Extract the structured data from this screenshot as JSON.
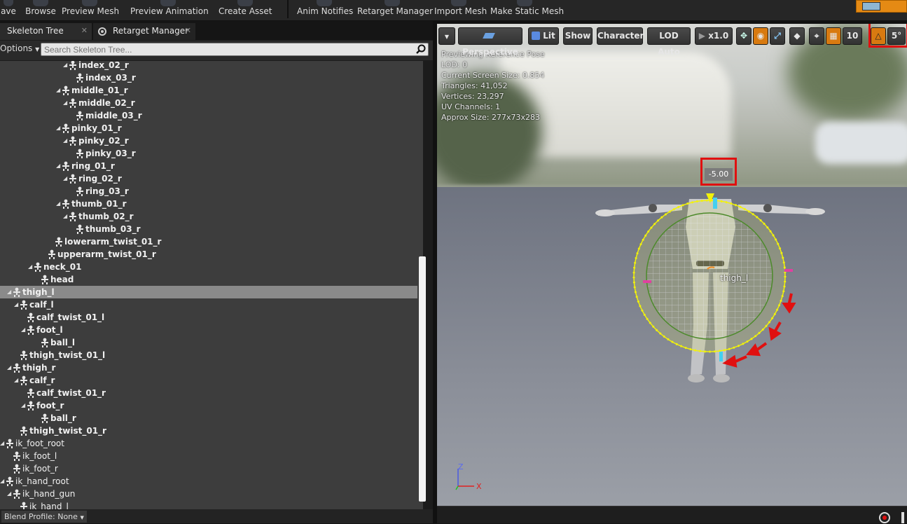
{
  "toolbar": {
    "items": [
      "ave",
      "Browse",
      "Preview Mesh",
      "Preview Animation",
      "Create Asset",
      "Anim Notifies",
      "Retarget Manager",
      "Import Mesh",
      "Make Static Mesh"
    ]
  },
  "tabs": {
    "skeleton_tree": "Skeleton Tree",
    "retarget_manager": "Retarget Manager",
    "close": "✕"
  },
  "options_label": "Options",
  "search": {
    "placeholder": "Search Skeleton Tree..."
  },
  "tree": [
    {
      "label": "index_02_r",
      "depth": 9,
      "expanded": true,
      "bold": true
    },
    {
      "label": "index_03_r",
      "depth": 10,
      "expanded": false,
      "bold": true
    },
    {
      "label": "middle_01_r",
      "depth": 8,
      "expanded": true,
      "bold": true
    },
    {
      "label": "middle_02_r",
      "depth": 9,
      "expanded": true,
      "bold": true
    },
    {
      "label": "middle_03_r",
      "depth": 10,
      "expanded": false,
      "bold": true
    },
    {
      "label": "pinky_01_r",
      "depth": 8,
      "expanded": true,
      "bold": true
    },
    {
      "label": "pinky_02_r",
      "depth": 9,
      "expanded": true,
      "bold": true
    },
    {
      "label": "pinky_03_r",
      "depth": 10,
      "expanded": false,
      "bold": true
    },
    {
      "label": "ring_01_r",
      "depth": 8,
      "expanded": true,
      "bold": true
    },
    {
      "label": "ring_02_r",
      "depth": 9,
      "expanded": true,
      "bold": true
    },
    {
      "label": "ring_03_r",
      "depth": 10,
      "expanded": false,
      "bold": true
    },
    {
      "label": "thumb_01_r",
      "depth": 8,
      "expanded": true,
      "bold": true
    },
    {
      "label": "thumb_02_r",
      "depth": 9,
      "expanded": true,
      "bold": true
    },
    {
      "label": "thumb_03_r",
      "depth": 10,
      "expanded": false,
      "bold": true
    },
    {
      "label": "lowerarm_twist_01_r",
      "depth": 7,
      "expanded": false,
      "bold": true
    },
    {
      "label": "upperarm_twist_01_r",
      "depth": 6,
      "expanded": false,
      "bold": true
    },
    {
      "label": "neck_01",
      "depth": 4,
      "expanded": true,
      "bold": true
    },
    {
      "label": "head",
      "depth": 5,
      "expanded": false,
      "bold": true
    },
    {
      "label": "thigh_l",
      "depth": 1,
      "expanded": true,
      "bold": true,
      "selected": true
    },
    {
      "label": "calf_l",
      "depth": 2,
      "expanded": true,
      "bold": true
    },
    {
      "label": "calf_twist_01_l",
      "depth": 3,
      "expanded": false,
      "bold": true
    },
    {
      "label": "foot_l",
      "depth": 3,
      "expanded": true,
      "bold": true
    },
    {
      "label": "ball_l",
      "depth": 5,
      "expanded": false,
      "bold": true
    },
    {
      "label": "thigh_twist_01_l",
      "depth": 2,
      "expanded": false,
      "bold": true
    },
    {
      "label": "thigh_r",
      "depth": 1,
      "expanded": true,
      "bold": true
    },
    {
      "label": "calf_r",
      "depth": 2,
      "expanded": true,
      "bold": true
    },
    {
      "label": "calf_twist_01_r",
      "depth": 3,
      "expanded": false,
      "bold": true
    },
    {
      "label": "foot_r",
      "depth": 3,
      "expanded": true,
      "bold": true
    },
    {
      "label": "ball_r",
      "depth": 5,
      "expanded": false,
      "bold": true
    },
    {
      "label": "thigh_twist_01_r",
      "depth": 2,
      "expanded": false,
      "bold": true
    },
    {
      "label": "ik_foot_root",
      "depth": 0,
      "expanded": true,
      "bold": false
    },
    {
      "label": "ik_foot_l",
      "depth": 1,
      "expanded": false,
      "bold": false
    },
    {
      "label": "ik_foot_r",
      "depth": 1,
      "expanded": false,
      "bold": false
    },
    {
      "label": "ik_hand_root",
      "depth": 0,
      "expanded": true,
      "bold": false
    },
    {
      "label": "ik_hand_gun",
      "depth": 1,
      "expanded": true,
      "bold": false
    },
    {
      "label": "ik_hand_l",
      "depth": 2,
      "expanded": false,
      "bold": false
    }
  ],
  "blend_profile": "Blend Profile: None",
  "viewport": {
    "buttons": {
      "perspective": "Perspective",
      "lit": "Lit",
      "show": "Show",
      "character": "Character",
      "lod": "LOD Auto",
      "speed": "x1.0",
      "grid_size": "10",
      "rot_snap": "5°"
    },
    "info": [
      "Previewing Reference Pose",
      "LOD: 0",
      "Current Screen Size: 0.854",
      "Triangles: 41,052",
      "Vertices: 23,297",
      "UV Channels: 1",
      "Approx Size: 277x73x283"
    ],
    "rotation_value": "-5.00",
    "bone_label": "thigh_l",
    "axis_z": "Z",
    "axis_x": "X"
  },
  "colors": {
    "highlight": "#e01010",
    "gizmo": "#f2f20a",
    "selection": "#8a8a8a"
  }
}
